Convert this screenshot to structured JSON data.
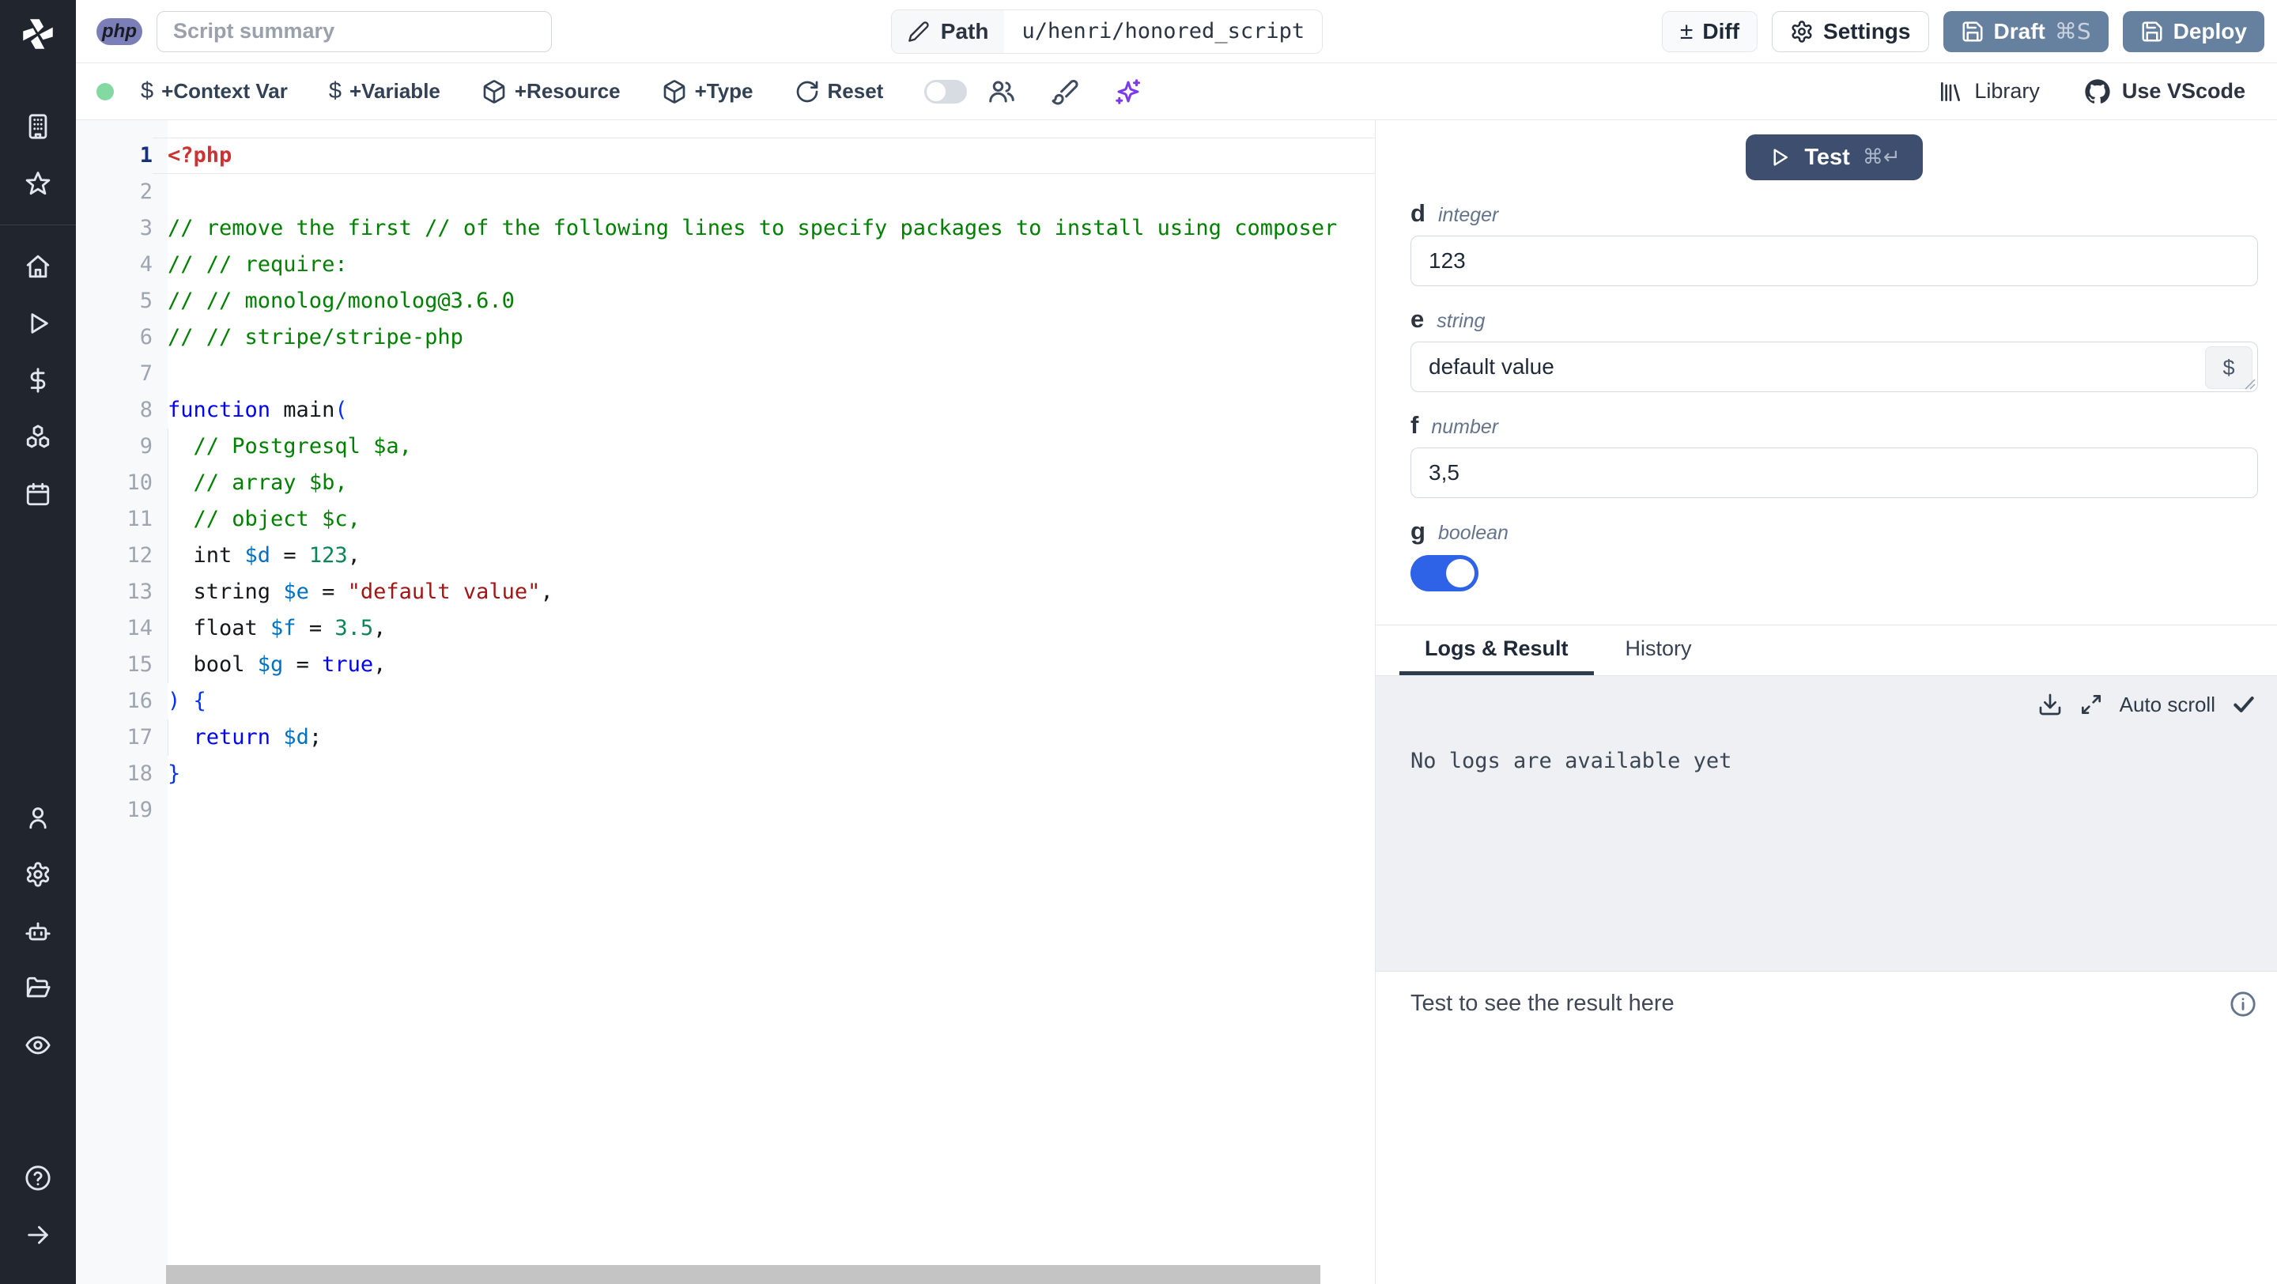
{
  "colors": {
    "brand_slate": "#66809f",
    "test_button": "#3d4e6e",
    "toggle_on": "#2e63e8",
    "php_badge": "#7b7fb8",
    "status_dot": "#84d9a3",
    "ai_accent": "#7c3aed"
  },
  "sidebar": {
    "icons": [
      "windmill-logo",
      "building",
      "star",
      "home",
      "play",
      "dollar",
      "boxes",
      "calendar",
      "user",
      "gear",
      "bot",
      "folder",
      "eye",
      "help",
      "arrow-right"
    ]
  },
  "topbar": {
    "language_badge": "php",
    "summary_placeholder": "Script summary",
    "path_label": "Path",
    "path_value": "u/henri/honored_script",
    "diff_label": "Diff",
    "diff_glyph": "±",
    "settings_label": "Settings",
    "draft_label": "Draft",
    "draft_shortcut": "⌘S",
    "deploy_label": "Deploy"
  },
  "toolbar": {
    "status": "connected",
    "items": [
      "+Context Var",
      "+Variable",
      "+Resource",
      "+Type",
      "Reset"
    ],
    "assistant_toggle": "off",
    "library_label": "Library",
    "vscode_label": "Use VScode"
  },
  "editor": {
    "language": "php",
    "lines": [
      {
        "n": 1,
        "current": true,
        "tokens": [
          {
            "c": "meta",
            "t": "<?php"
          }
        ]
      },
      {
        "n": 2,
        "tokens": []
      },
      {
        "n": 3,
        "tokens": [
          {
            "c": "comment",
            "t": "// remove the first // of the following lines to specify packages to install using composer"
          }
        ]
      },
      {
        "n": 4,
        "tokens": [
          {
            "c": "comment",
            "t": "// // require:"
          }
        ]
      },
      {
        "n": 5,
        "tokens": [
          {
            "c": "comment",
            "t": "// // monolog/monolog@3.6.0"
          }
        ]
      },
      {
        "n": 6,
        "tokens": [
          {
            "c": "comment",
            "t": "// // stripe/stripe-php"
          }
        ]
      },
      {
        "n": 7,
        "tokens": []
      },
      {
        "n": 8,
        "tokens": [
          {
            "c": "keyword",
            "t": "function"
          },
          {
            "c": "plain",
            "t": " main"
          },
          {
            "c": "delim",
            "t": "("
          }
        ]
      },
      {
        "n": 9,
        "guide": true,
        "tokens": [
          {
            "c": "plain",
            "t": "  "
          },
          {
            "c": "comment",
            "t": "// Postgresql $a,"
          }
        ]
      },
      {
        "n": 10,
        "guide": true,
        "tokens": [
          {
            "c": "plain",
            "t": "  "
          },
          {
            "c": "comment",
            "t": "// array $b,"
          }
        ]
      },
      {
        "n": 11,
        "guide": true,
        "tokens": [
          {
            "c": "plain",
            "t": "  "
          },
          {
            "c": "comment",
            "t": "// object $c,"
          }
        ]
      },
      {
        "n": 12,
        "guide": true,
        "tokens": [
          {
            "c": "plain",
            "t": "  int "
          },
          {
            "c": "var",
            "t": "$d"
          },
          {
            "c": "plain",
            "t": " = "
          },
          {
            "c": "num",
            "t": "123"
          },
          {
            "c": "plain",
            "t": ","
          }
        ]
      },
      {
        "n": 13,
        "guide": true,
        "tokens": [
          {
            "c": "plain",
            "t": "  string "
          },
          {
            "c": "var",
            "t": "$e"
          },
          {
            "c": "plain",
            "t": " = "
          },
          {
            "c": "str",
            "t": "\"default value\""
          },
          {
            "c": "plain",
            "t": ","
          }
        ]
      },
      {
        "n": 14,
        "guide": true,
        "tokens": [
          {
            "c": "plain",
            "t": "  float "
          },
          {
            "c": "var",
            "t": "$f"
          },
          {
            "c": "plain",
            "t": " = "
          },
          {
            "c": "num",
            "t": "3.5"
          },
          {
            "c": "plain",
            "t": ","
          }
        ]
      },
      {
        "n": 15,
        "guide": true,
        "tokens": [
          {
            "c": "plain",
            "t": "  bool "
          },
          {
            "c": "var",
            "t": "$g"
          },
          {
            "c": "plain",
            "t": " = "
          },
          {
            "c": "keyword",
            "t": "true"
          },
          {
            "c": "plain",
            "t": ","
          }
        ]
      },
      {
        "n": 16,
        "tokens": [
          {
            "c": "delim",
            "t": ") {"
          }
        ]
      },
      {
        "n": 17,
        "guide": true,
        "tokens": [
          {
            "c": "plain",
            "t": "  "
          },
          {
            "c": "keyword",
            "t": "return"
          },
          {
            "c": "plain",
            "t": " "
          },
          {
            "c": "var",
            "t": "$d"
          },
          {
            "c": "plain",
            "t": ";"
          }
        ]
      },
      {
        "n": 18,
        "tokens": [
          {
            "c": "delim",
            "t": "}"
          }
        ]
      },
      {
        "n": 19,
        "tokens": []
      }
    ]
  },
  "form": {
    "test_label": "Test",
    "test_shortcut": "⌘↵",
    "var_picker_label": "$",
    "fields": [
      {
        "name": "d",
        "type": "integer",
        "value": "123"
      },
      {
        "name": "e",
        "type": "string",
        "value": "default value"
      },
      {
        "name": "f",
        "type": "number",
        "value": "3,5"
      },
      {
        "name": "g",
        "type": "boolean",
        "value": "true"
      }
    ]
  },
  "output": {
    "tabs": [
      "Logs & Result",
      "History"
    ],
    "active_tab": "Logs & Result",
    "autoscroll_label": "Auto scroll",
    "no_logs_message": "No logs are available yet",
    "result_placeholder": "Test to see the result here"
  }
}
